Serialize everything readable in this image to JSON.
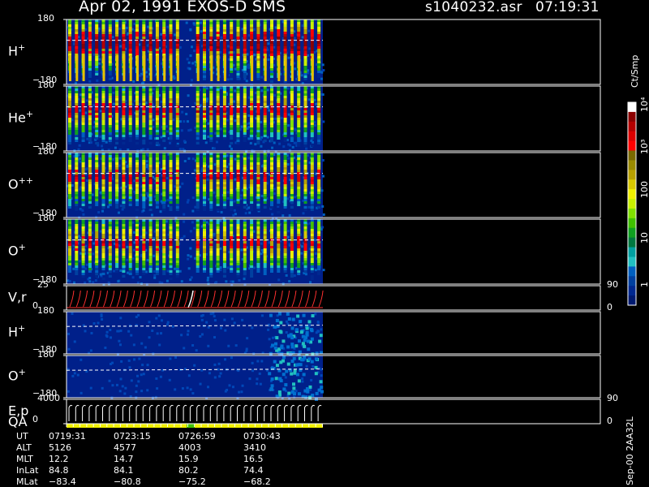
{
  "header": {
    "title": "Apr 02, 1991    EXOS-D SMS",
    "file": "s1040232.asr",
    "time": "07:19:31"
  },
  "colorbar": {
    "unit": "Ct/Smp",
    "tick_labels": [
      "10⁴",
      "10³",
      "100",
      "10",
      "1"
    ],
    "colors": [
      "#ffffff",
      "#8b0000",
      "#b40000",
      "#dc0000",
      "#ff0000",
      "#7a6a00",
      "#9a8a00",
      "#b8a000",
      "#d8c800",
      "#f0f000",
      "#c8f000",
      "#80e000",
      "#40c000",
      "#10a020",
      "#007840",
      "#00a0a0",
      "#20c0c0",
      "#0060c0",
      "#0040a0",
      "#002890",
      "#001a70"
    ]
  },
  "rows": [
    {
      "name": "row-hplus",
      "label": "H",
      "sup": "+",
      "ymax": "180",
      "ymin": "−180"
    },
    {
      "name": "row-heplus",
      "label": "He",
      "sup": "+",
      "ymax": "180",
      "ymin": "−180"
    },
    {
      "name": "row-oplusplus",
      "label": "O",
      "sup": "++",
      "ymax": "180",
      "ymin": "−180"
    },
    {
      "name": "row-oplus",
      "label": "O",
      "sup": "+",
      "ymax": "180",
      "ymin": "−180"
    },
    {
      "name": "row-vr",
      "label": "V,r",
      "sup": "",
      "ymax": "25",
      "ymin": "0",
      "right_top": "90",
      "right_bottom": "0"
    },
    {
      "name": "row-hplus-2",
      "label": "H",
      "sup": "+",
      "ymax": "180",
      "ymin": "−180"
    },
    {
      "name": "row-oplus-2",
      "label": "O",
      "sup": "+",
      "ymax": "180",
      "ymin": "−180"
    },
    {
      "name": "row-ep",
      "label": "E,p",
      "sup": "",
      "ymax": "4000",
      "ymin": "0",
      "right_top": "90",
      "right_bottom": "0"
    }
  ],
  "qa_label": "QA",
  "side_note": "Sep-00 2AA32L",
  "table": {
    "row_labels": [
      "UT",
      "ALT",
      "MLT",
      "InLat",
      "MLat"
    ],
    "columns": [
      [
        "0719:31",
        "5126",
        "12.2",
        "84.8",
        "−83.4"
      ],
      [
        "0723:15",
        "4577",
        "14.7",
        "84.1",
        "−80.8"
      ],
      [
        "0726:59",
        "4003",
        "15.9",
        "80.2",
        "−75.2"
      ],
      [
        "0730:43",
        "3410",
        "16.5",
        "74.4",
        "−68.2"
      ]
    ]
  },
  "chart_data": {
    "type": "heatmap",
    "title": "Apr 02, 1991    EXOS-D SMS",
    "x_ticks": [
      "0719:31",
      "0723:15",
      "0726:59",
      "0730:43"
    ],
    "panels": [
      "H+",
      "He+",
      "O++",
      "O+",
      "V,r",
      "H+",
      "O+",
      "E,p"
    ],
    "color_scale": "log",
    "color_range": [
      1,
      10000
    ],
    "color_unit": "Ct/Smp"
  }
}
